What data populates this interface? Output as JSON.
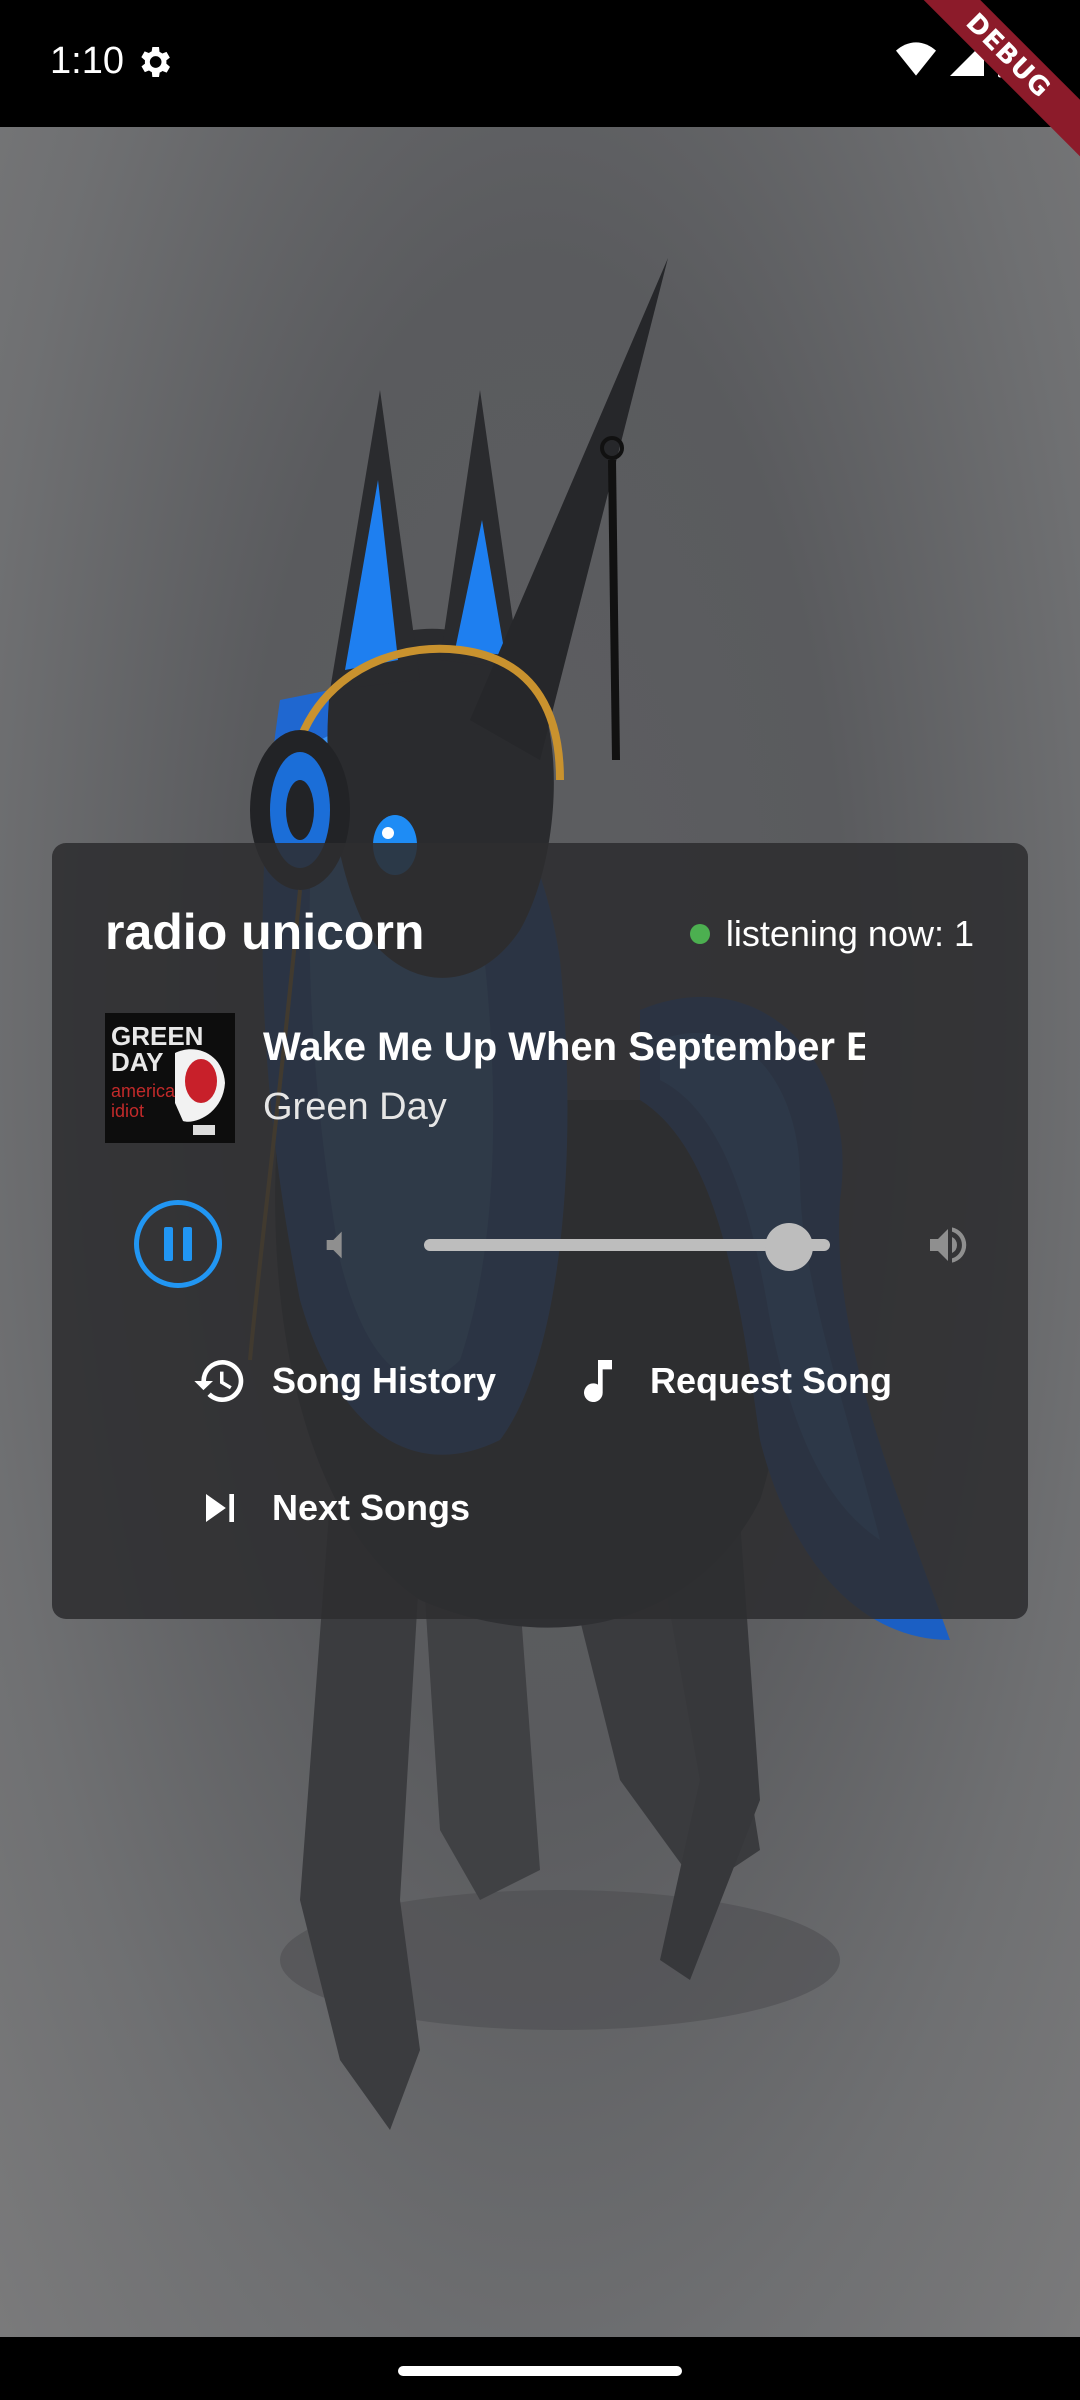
{
  "status_bar": {
    "time": "1:10",
    "debug_label": "DEBUG"
  },
  "player": {
    "station_name": "radio unicorn",
    "listening_text": "listening now: 1",
    "live_dot_color": "#4caf50",
    "album_art": {
      "line1": "GREEN",
      "line2": "DAY",
      "line3": "american",
      "line4": "idiot"
    },
    "track_title": "Wake Me Up When September Ends",
    "track_artist": "Green Day",
    "playback_state": "playing",
    "accent_color": "#2196f3",
    "volume": 0.9,
    "actions": {
      "song_history": "Song History",
      "request_song": "Request Song",
      "next_songs": "Next Songs"
    }
  }
}
